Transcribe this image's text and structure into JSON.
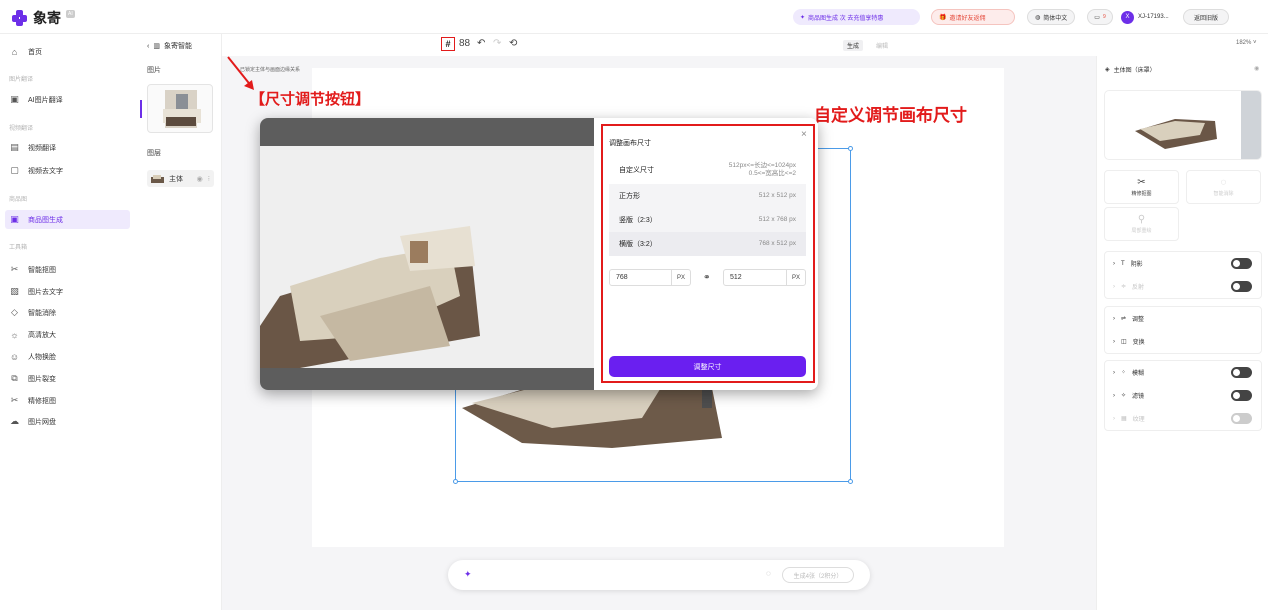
{
  "header": {
    "app_name": "象寄",
    "app_badge": "AI",
    "promo_label": "商品图生成 次 去充值享特惠",
    "invite_label": "邀请好友返佣",
    "language_label": "简体中文",
    "message_count": "9",
    "user_avatar_letter": "X",
    "user_id": "XJ-17193...",
    "old_version_label": "返回旧版"
  },
  "sidebar": {
    "home": "首页",
    "sec_image_translate": "图片翻译",
    "ai_image_translate": "AI图片翻译",
    "sec_video_translate": "视频翻译",
    "video_translate": "视频翻译",
    "video_remove_text": "视频去文字",
    "sec_product": "商品图",
    "product_image_gen": "商品图生成",
    "sec_toolbox": "工具箱",
    "smart_cutout": "智能抠图",
    "image_remove_text": "图片去文字",
    "smart_erase": "智能消除",
    "hd_upscale": "高清放大",
    "face_swap": "人物换脸",
    "image_split": "图片裂变",
    "precise_cutout": "精修抠图",
    "image_cloud": "图片网盘"
  },
  "assets": {
    "back_label": "象寄智能",
    "images_label": "图片",
    "layers_label": "图层",
    "layer_name": "主体"
  },
  "toolbar": {
    "tab_generate": "生成",
    "tab_edit": "编辑",
    "zoom": "182%",
    "small_hint": "已锁定主体与画面边缘关系"
  },
  "annotations": {
    "resize_button": "【尺寸调节按钮】",
    "custom_canvas": "自定义调节画布尺寸"
  },
  "dialog": {
    "title": "调整画布尺寸",
    "options": [
      {
        "label": "自定义尺寸",
        "value": "512px<=长边<=1024px\n0.5<=宽高比<=2"
      },
      {
        "label": "正方形",
        "value": "512 x 512 px"
      },
      {
        "label": "竖版（2:3）",
        "value": "512 x 768 px"
      },
      {
        "label": "横版（3:2）",
        "value": "768 x 512 px"
      }
    ],
    "width_value": "768",
    "height_value": "512",
    "unit": "PX",
    "apply_label": "调整尺寸"
  },
  "prompt": {
    "generate_label": "生成4张（2积分）"
  },
  "right_panel": {
    "title": "主体图（床罩）",
    "smart_cutout_card": "精修抠图",
    "card_disabled_1": "智能消除",
    "card_disabled_2": "局部重绘",
    "shadow": "阴影",
    "reflection": "反射",
    "adjust": "调整",
    "transform": "变换",
    "blur": "模糊",
    "filter": "滤镜",
    "texture": "纹理"
  },
  "colors": {
    "brand": "#6d2fe8",
    "annotation_red": "#e21b1b",
    "selection_blue": "#4b9be8"
  }
}
